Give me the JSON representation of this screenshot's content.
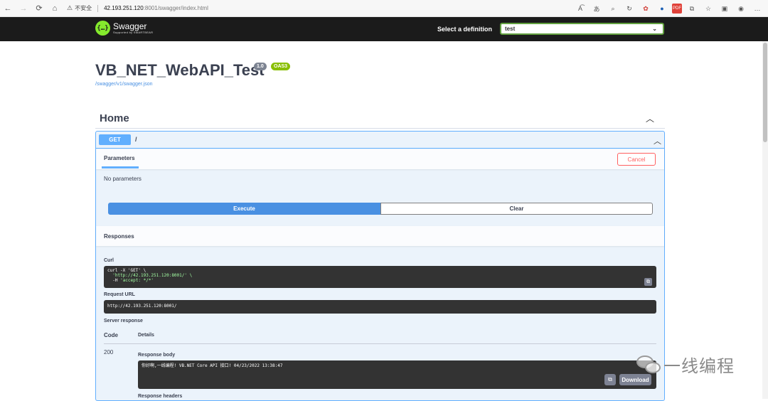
{
  "browser": {
    "back": "←",
    "forward": "→",
    "reload": "⟳",
    "home": "⌂",
    "warning_icon": "⚠",
    "insecure_text": "不安全",
    "url_host": "42.193.251.120",
    "url_rest": ":8001/swagger/index.html",
    "toolbar_icons": [
      "read-aloud-icon",
      "translate-icon",
      "zoom-icon",
      "refresh-page-icon",
      "extension-red-icon",
      "extension-blue-icon",
      "pdf-icon",
      "extension-icon",
      "favorites-icon",
      "collections-icon",
      "profile-icon",
      "more-icon"
    ]
  },
  "topbar": {
    "logo_mark": "{…}",
    "logo_title": "Swagger",
    "logo_sub": "Supported by SMARTBEAR",
    "select_label": "Select a definition",
    "selected_definition": "test"
  },
  "info": {
    "title": "VB_NET_WebAPI_Test",
    "version": "1.0",
    "oas": "OAS3",
    "json_link": "/swagger/v1/swagger.json"
  },
  "tag": {
    "name": "Home"
  },
  "operation": {
    "method": "GET",
    "path": "/",
    "parameters_tab": "Parameters",
    "cancel_label": "Cancel",
    "no_parameters": "No parameters",
    "execute_label": "Execute",
    "clear_label": "Clear",
    "responses_title": "Responses",
    "curl_label": "Curl",
    "curl_line1": "curl -X 'GET' \\",
    "curl_line2": "'http://42.193.251.120:8001/' \\",
    "curl_line3_flag": "-H ",
    "curl_line3_str": "'accept: */*'",
    "request_url_label": "Request URL",
    "request_url": "http://42.193.251.120:8001/",
    "server_response_label": "Server response",
    "col_code": "Code",
    "col_details": "Details",
    "status_code": "200",
    "response_body_label": "Response body",
    "response_body": "你好啊,一线编程! VB.NET Core API 接口! 04/23/2022 13:38:47",
    "download_label": "Download",
    "response_headers_label": "Response headers"
  },
  "watermark": {
    "text": "一线编程"
  },
  "colors": {
    "get_blue": "#61affe",
    "execute_blue": "#4990e2",
    "cancel_red": "#ff6060",
    "swagger_green": "#85ea2d",
    "oas_green": "#89bf04",
    "topbar_bg": "#1b1b1b"
  }
}
